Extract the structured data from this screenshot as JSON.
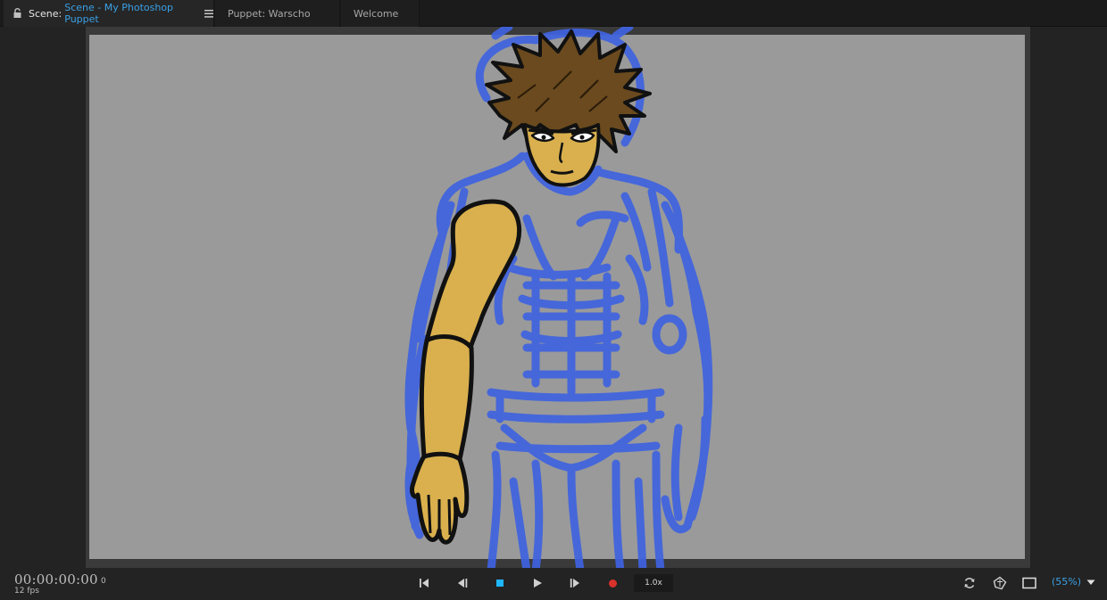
{
  "tabs": {
    "scene": {
      "prefix": "Scene:",
      "name": "Scene - My Photoshop Puppet"
    },
    "puppet": {
      "label": "Puppet: Warscho"
    },
    "welcome": {
      "label": "Welcome"
    }
  },
  "transport": {
    "timecode": "00:00:00:00",
    "frame": "0",
    "fps": "12 fps",
    "speed": "1.0x",
    "zoom": "(55%)"
  },
  "icons": {
    "lock": "lock-icon",
    "menu": "hamburger-menu-icon",
    "go_to_start": "go-to-start-icon",
    "step_back": "step-back-icon",
    "stop": "stop-icon",
    "play": "play-icon",
    "step_forward": "step-forward-icon",
    "record": "record-icon",
    "refresh": "refresh-icon",
    "puppet_track": "puppet-track-icon",
    "frame": "frame-icon",
    "dropdown": "chevron-down-icon"
  },
  "colors": {
    "accent": "#3aa0e6",
    "stop": "#1fb6ff",
    "record": "#d9312b",
    "canvas": "#9a9a9a",
    "sketch": "#3f63e0",
    "skin": "#d9b04d",
    "hair": "#6a4a1e"
  }
}
